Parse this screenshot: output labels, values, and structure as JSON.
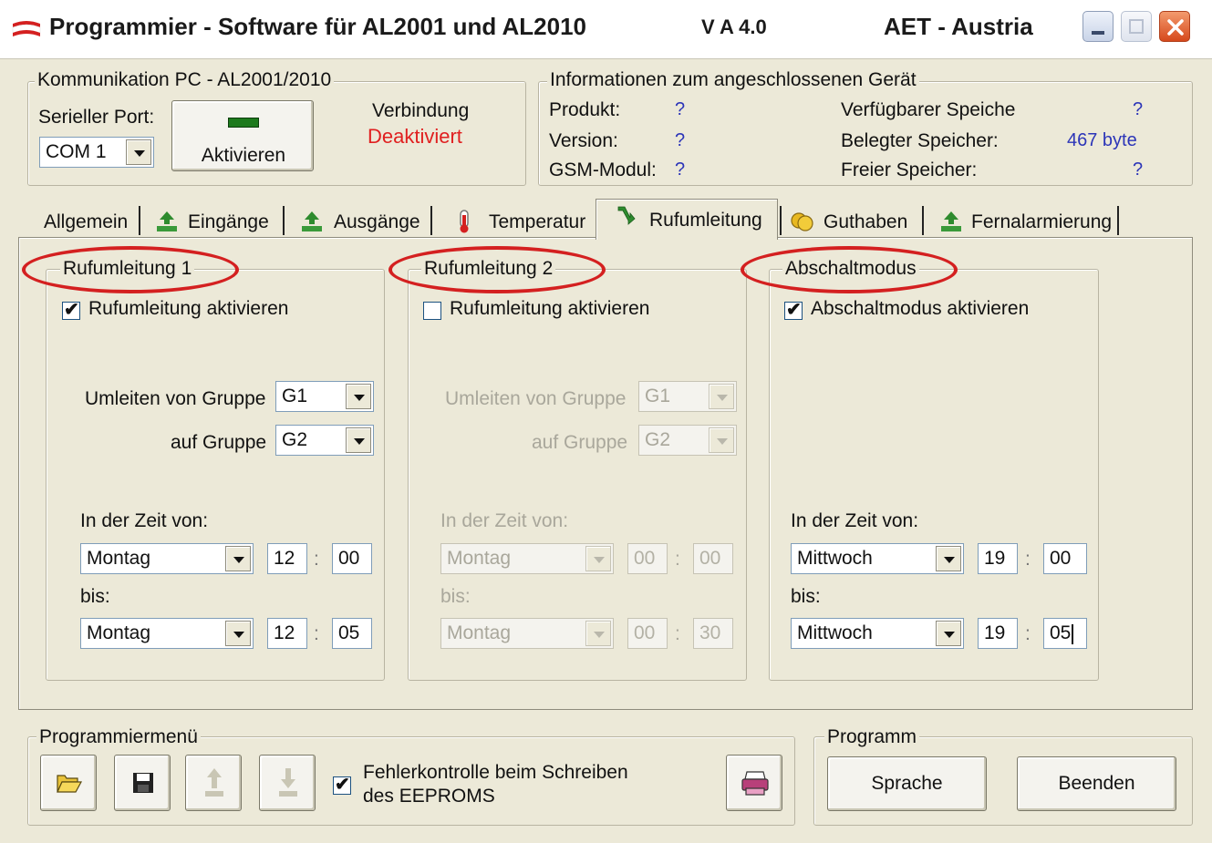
{
  "window": {
    "title": "Programmier - Software für AL2001 und AL2010",
    "version": "V A 4.0",
    "company": "AET - Austria"
  },
  "komm": {
    "group_label": "Kommunikation PC - AL2001/2010",
    "port_label": "Serieller Port:",
    "port_value": "COM 1",
    "activate_label": "Aktivieren",
    "verbindung_label": "Verbindung",
    "verbindung_status": "Deaktiviert"
  },
  "info": {
    "group_label": "Informationen zum angeschlossenen Gerät",
    "produkt_label": "Produkt:",
    "produkt_value": "?",
    "version_label": "Version:",
    "version_value": "?",
    "gsm_label": "GSM-Modul:",
    "gsm_value": "?",
    "verfuegbar_label": "Verfügbarer Speiche",
    "verfuegbar_value": "?",
    "belegt_label": "Belegter Speicher:",
    "belegt_value": "467 byte",
    "frei_label": "Freier Speicher:",
    "frei_value": "?"
  },
  "tabs": [
    {
      "label": "Allgemein"
    },
    {
      "label": "Eingänge"
    },
    {
      "label": "Ausgänge"
    },
    {
      "label": "Temperatur"
    },
    {
      "label": "Rufumleitung"
    },
    {
      "label": "Guthaben"
    },
    {
      "label": "Fernalarmierung"
    }
  ],
  "ruf1": {
    "title": "Rufumleitung 1",
    "checkbox_label": "Rufumleitung aktivieren",
    "checked": true,
    "umleiten_label": "Umleiten von Gruppe",
    "umleiten_value": "G1",
    "auf_label": "auf Gruppe",
    "auf_value": "G2",
    "zeit_label": "In der Zeit von:",
    "von_day": "Montag",
    "von_h": "12",
    "von_m": "00",
    "bis_label": "bis:",
    "bis_day": "Montag",
    "bis_h": "12",
    "bis_m": "05"
  },
  "ruf2": {
    "title": "Rufumleitung 2",
    "checkbox_label": "Rufumleitung aktivieren",
    "checked": false,
    "umleiten_label": "Umleiten von Gruppe",
    "umleiten_value": "G1",
    "auf_label": "auf Gruppe",
    "auf_value": "G2",
    "zeit_label": "In der Zeit von:",
    "von_day": "Montag",
    "von_h": "00",
    "von_m": "00",
    "bis_label": "bis:",
    "bis_day": "Montag",
    "bis_h": "00",
    "bis_m": "30"
  },
  "abschalt": {
    "title": "Abschaltmodus",
    "checkbox_label": "Abschaltmodus aktivieren",
    "checked": true,
    "zeit_label": "In der Zeit von:",
    "von_day": "Mittwoch",
    "von_h": "19",
    "von_m": "00",
    "bis_label": "bis:",
    "bis_day": "Mittwoch",
    "bis_h": "19",
    "bis_m": "05"
  },
  "colon": ":",
  "menu": {
    "group_label": "Programmiermenü",
    "fehler_label_1": "Fehlerkontrolle beim Schreiben",
    "fehler_label_2": "des EEPROMS",
    "fehler_checked": true
  },
  "programm": {
    "group_label": "Programm",
    "sprache_label": "Sprache",
    "beenden_label": "Beenden"
  },
  "colors": {
    "accent_red": "#d42020",
    "status_red": "#e02020",
    "info_blue": "#2c35b8",
    "panel": "#ece9d8"
  }
}
